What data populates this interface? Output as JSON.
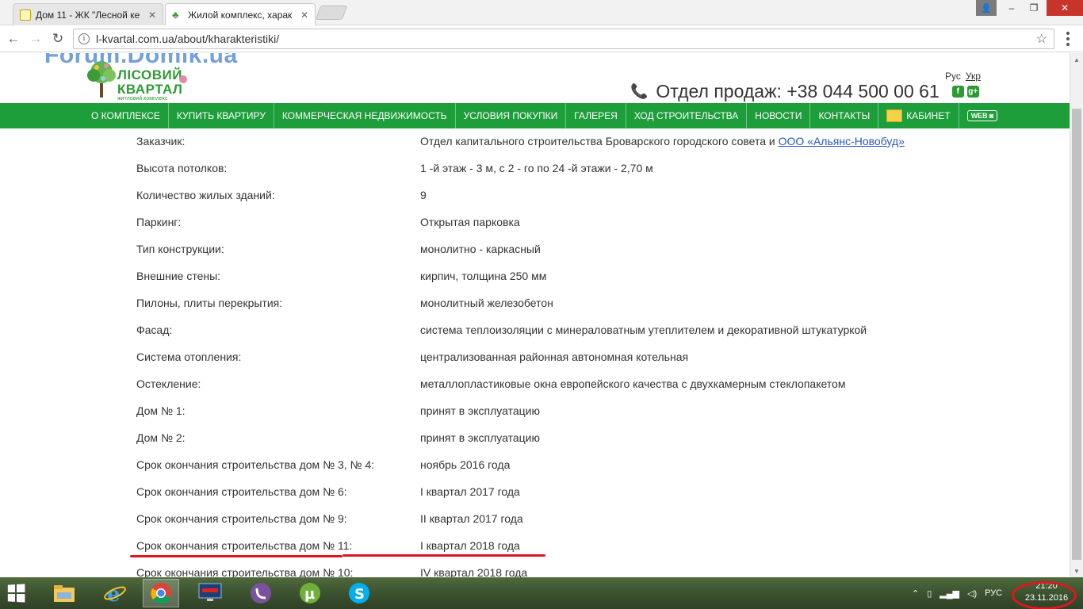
{
  "browser": {
    "tabs": [
      {
        "title": "Дом 11 - ЖК \"Лесной ке",
        "active": false
      },
      {
        "title": "Жилой комплекс, харак",
        "active": true
      }
    ],
    "url": "l-kvartal.com.ua/about/kharakteristiki/",
    "window_controls": {
      "minimize": "‒",
      "maximize": "❐",
      "close": "✕"
    },
    "nav": {
      "back": "←",
      "forward": "→",
      "reload": "↻"
    }
  },
  "watermark": "Forum.Domik.ua",
  "logo": {
    "line1": "ЛІСОВИЙ",
    "line2": "КВАРТАЛ",
    "tagline": "житловий комплекс"
  },
  "header": {
    "lang": {
      "ru": "Рус",
      "uk": "Укр"
    },
    "phone_label": "Отдел продаж: +38 044 500 00 61",
    "social": {
      "facebook": "f",
      "google": "g+"
    }
  },
  "menu": [
    "О КОМПЛЕКСЕ",
    "КУПИТЬ КВАРТИРУ",
    "КОММЕРЧЕСКАЯ НЕДВИЖИМОСТЬ",
    "УСЛОВИЯ ПОКУПКИ",
    "ГАЛЕРЕЯ",
    "ХОД СТРОИТЕЛЬСТВА",
    "НОВОСТИ",
    "КОНТАКТЫ",
    "КАБИНЕТ",
    "WEB"
  ],
  "specs": [
    {
      "label": "Заказчик:",
      "value": "Отдел капитального строительства Броварского городского совета и ",
      "link": "ООО «Альянс-Новобуд»"
    },
    {
      "label": "Высота потолков:",
      "value": "1 -й этаж - 3 м, с 2 - го по 24 -й этажи - 2,70 м"
    },
    {
      "label": "Количество жилых зданий:",
      "value": "9"
    },
    {
      "label": "Паркинг:",
      "value": "Открытая парковка"
    },
    {
      "label": "Тип конструкции:",
      "value": "монолитно - каркасный"
    },
    {
      "label": "Внешние стены:",
      "value": "кирпич, толщина 250 мм"
    },
    {
      "label": "Пилоны, плиты перекрытия:",
      "value": "монолитный железобетон"
    },
    {
      "label": "Фасад:",
      "value": "система теплоизоляции с минераловатным утеплителем и декоративной штукатуркой"
    },
    {
      "label": "Система отопления:",
      "value": "централизованная районная автономная котельная"
    },
    {
      "label": "Остекление:",
      "value": "металлопластиковые окна европейского качества с двухкамерным стеклопакетом"
    },
    {
      "label": "Дом № 1:",
      "value": "принят в эксплуатацию"
    },
    {
      "label": "Дом № 2:",
      "value": "принят в эксплуатацию"
    },
    {
      "label": "Срок окончания строительства дом № 3, № 4:",
      "value": "ноябрь 2016 года"
    },
    {
      "label": "Срок окончания строительства дом № 6:",
      "value": "I квартал 2017 года"
    },
    {
      "label": "Срок окончания строительства дом № 9:",
      "value": "II квартал 2017 года"
    },
    {
      "label": "Срок окончания строительства дом № 11:",
      "value": "I квартал 2018 года"
    },
    {
      "label": "Срок окончания строительства дом № 10:",
      "value": "IV квартал 2018 года"
    }
  ],
  "taskbar": {
    "apps": [
      "file-explorer",
      "internet-explorer",
      "chrome",
      "lenovo",
      "viber",
      "utorrent",
      "skype"
    ],
    "tray_lang": "РУС",
    "time": "21:20",
    "date": "23.11.2016"
  },
  "colors": {
    "menu_green": "#1d9e3a",
    "annotation_red": "#e0161e",
    "link_blue": "#2a55c6"
  }
}
